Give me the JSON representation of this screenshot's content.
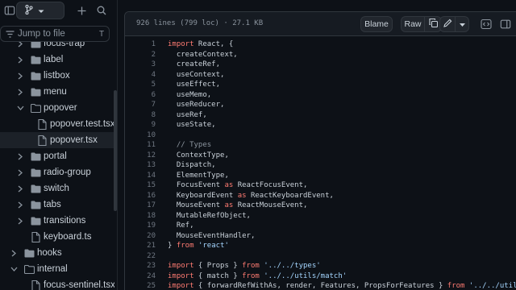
{
  "sidebar": {
    "jump_placeholder": "Jump to file",
    "jump_shortcut": "T",
    "tree": [
      {
        "label": "focus-trap",
        "type": "folder",
        "open": false
      },
      {
        "label": "label",
        "type": "folder",
        "open": false
      },
      {
        "label": "listbox",
        "type": "folder",
        "open": false
      },
      {
        "label": "menu",
        "type": "folder",
        "open": false
      },
      {
        "label": "popover",
        "type": "folder",
        "open": true
      },
      {
        "label": "popover.test.tsx",
        "type": "file"
      },
      {
        "label": "popover.tsx",
        "type": "file",
        "selected": true
      },
      {
        "label": "portal",
        "type": "folder",
        "open": false
      },
      {
        "label": "radio-group",
        "type": "folder",
        "open": false
      },
      {
        "label": "switch",
        "type": "folder",
        "open": false
      },
      {
        "label": "tabs",
        "type": "folder",
        "open": false
      },
      {
        "label": "transitions",
        "type": "folder",
        "open": false
      },
      {
        "label": "keyboard.ts",
        "type": "file"
      },
      {
        "label": "hooks",
        "type": "folder",
        "open": false
      },
      {
        "label": "internal",
        "type": "folder",
        "open": true
      },
      {
        "label": "focus-sentinel.tsx",
        "type": "file"
      }
    ]
  },
  "file": {
    "info": "926 lines (799 loc) · 27.1 KB",
    "blame_label": "Blame",
    "raw_label": "Raw"
  },
  "code_lines": [
    {
      "n": "1",
      "html": "<span class=\"kw\">import</span> React, {"
    },
    {
      "n": "2",
      "html": "  createContext,"
    },
    {
      "n": "3",
      "html": "  createRef,"
    },
    {
      "n": "4",
      "html": "  useContext,"
    },
    {
      "n": "5",
      "html": "  useEffect,"
    },
    {
      "n": "6",
      "html": "  useMemo,"
    },
    {
      "n": "7",
      "html": "  useReducer,"
    },
    {
      "n": "8",
      "html": "  useRef,"
    },
    {
      "n": "9",
      "html": "  useState,"
    },
    {
      "n": "10",
      "html": ""
    },
    {
      "n": "11",
      "html": "  <span class=\"cm\">// Types</span>"
    },
    {
      "n": "12",
      "html": "  ContextType,"
    },
    {
      "n": "13",
      "html": "  Dispatch,"
    },
    {
      "n": "14",
      "html": "  ElementType,"
    },
    {
      "n": "15",
      "html": "  FocusEvent <span class=\"kw\">as</span> ReactFocusEvent,"
    },
    {
      "n": "16",
      "html": "  KeyboardEvent <span class=\"kw\">as</span> ReactKeyboardEvent,"
    },
    {
      "n": "17",
      "html": "  MouseEvent <span class=\"kw\">as</span> ReactMouseEvent,"
    },
    {
      "n": "18",
      "html": "  MutableRefObject,"
    },
    {
      "n": "19",
      "html": "  Ref,"
    },
    {
      "n": "20",
      "html": "  MouseEventHandler,"
    },
    {
      "n": "21",
      "html": "} <span class=\"kw\">from</span> <span class=\"str\">'react'</span>"
    },
    {
      "n": "22",
      "html": ""
    },
    {
      "n": "23",
      "html": "<span class=\"kw\">import</span> { Props } <span class=\"kw\">from</span> <span class=\"str\">'../../types'</span>"
    },
    {
      "n": "24",
      "html": "<span class=\"kw\">import</span> { match } <span class=\"kw\">from</span> <span class=\"str\">'../../utils/match'</span>"
    },
    {
      "n": "25",
      "html": "<span class=\"kw\">import</span> { forwardRefWithAs, render, Features, PropsForFeatures } <span class=\"kw\">from</span> <span class=\"str\">'../../utils/render'</span>"
    }
  ]
}
